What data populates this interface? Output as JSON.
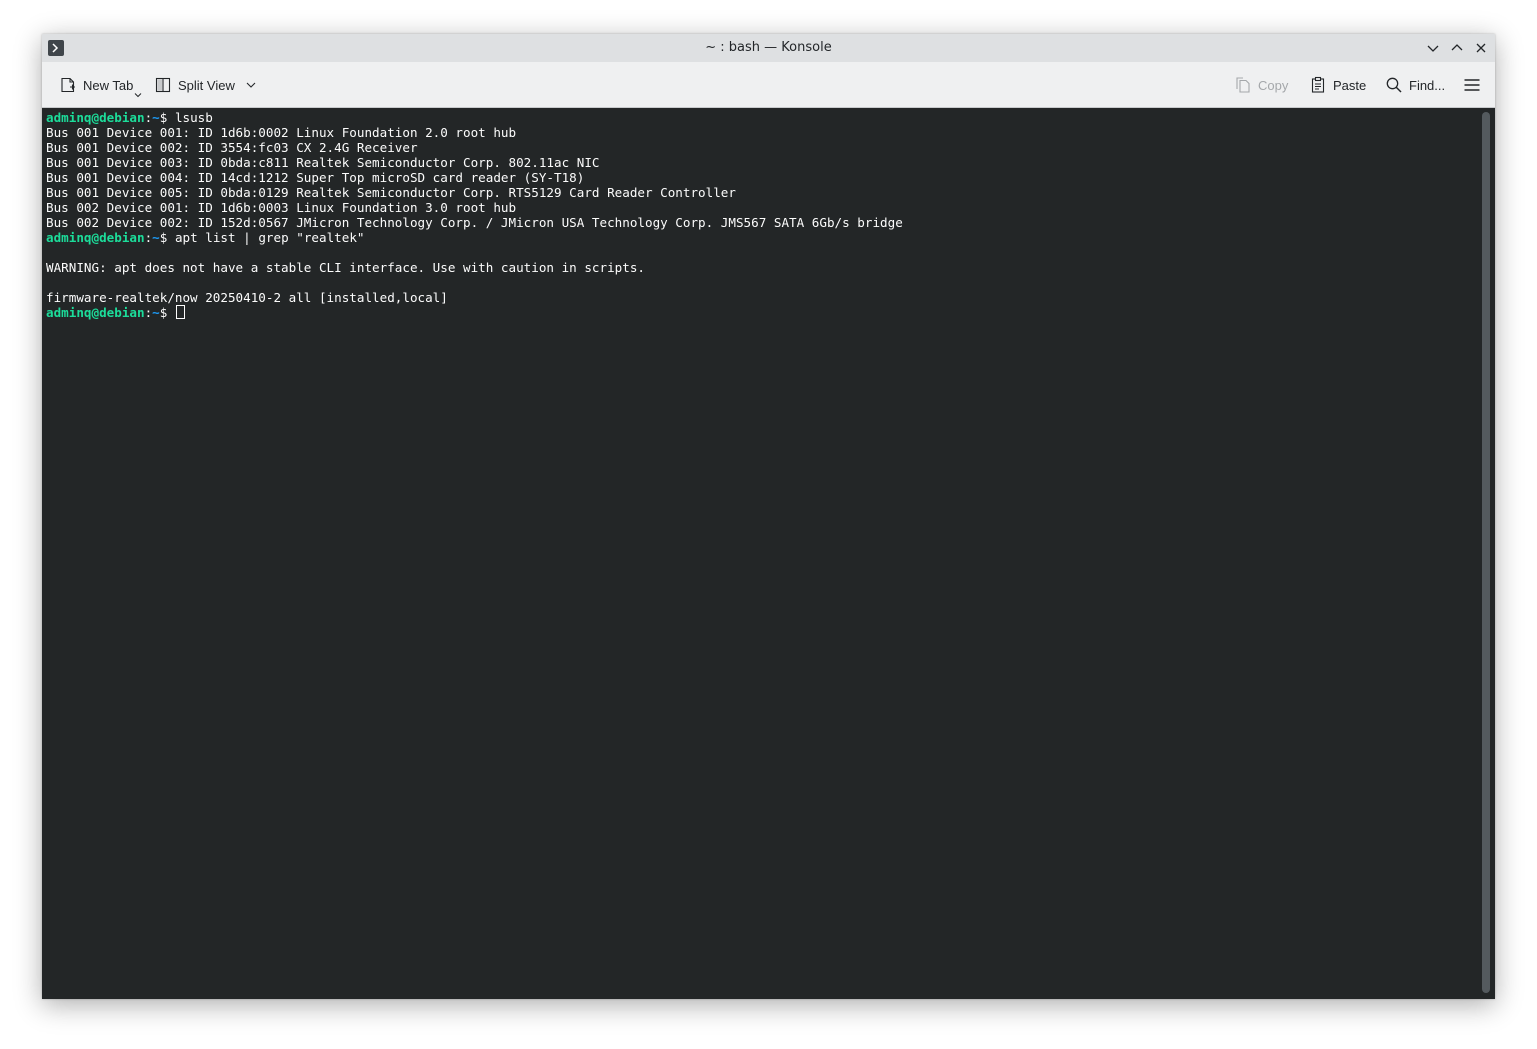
{
  "window": {
    "title": "~ : bash — Konsole",
    "icons": {
      "app": "konsole-terminal-icon",
      "minimize": "chevron-down-icon",
      "maximize": "chevron-up-icon",
      "close": "close-icon"
    }
  },
  "toolbar": {
    "new_tab": "New Tab",
    "split_view": "Split View",
    "copy": "Copy",
    "paste": "Paste",
    "find": "Find...",
    "copy_enabled": false
  },
  "prompt": {
    "user_host": "adminq@debian",
    "separator": ":",
    "path": "~",
    "symbol": "$ "
  },
  "terminal": {
    "lines": [
      {
        "type": "prompt",
        "text": "lsusb"
      },
      {
        "type": "output",
        "text": "Bus 001 Device 001: ID 1d6b:0002 Linux Foundation 2.0 root hub"
      },
      {
        "type": "output",
        "text": "Bus 001 Device 002: ID 3554:fc03 CX 2.4G Receiver"
      },
      {
        "type": "output",
        "text": "Bus 001 Device 003: ID 0bda:c811 Realtek Semiconductor Corp. 802.11ac NIC"
      },
      {
        "type": "output",
        "text": "Bus 001 Device 004: ID 14cd:1212 Super Top microSD card reader (SY-T18)"
      },
      {
        "type": "output",
        "text": "Bus 001 Device 005: ID 0bda:0129 Realtek Semiconductor Corp. RTS5129 Card Reader Controller"
      },
      {
        "type": "output",
        "text": "Bus 002 Device 001: ID 1d6b:0003 Linux Foundation 3.0 root hub"
      },
      {
        "type": "output",
        "text": "Bus 002 Device 002: ID 152d:0567 JMicron Technology Corp. / JMicron USA Technology Corp. JMS567 SATA 6Gb/s bridge"
      },
      {
        "type": "prompt",
        "text": "apt list | grep \"realtek\""
      },
      {
        "type": "output",
        "text": ""
      },
      {
        "type": "output",
        "text": "WARNING: apt does not have a stable CLI interface. Use with caution in scripts."
      },
      {
        "type": "output",
        "text": ""
      },
      {
        "type": "output",
        "text": "firmware-realtek/now 20250410-2 all [installed,local]"
      },
      {
        "type": "prompt_active",
        "text": ""
      }
    ]
  },
  "colors": {
    "terminal_bg": "#232627",
    "terminal_fg": "#fcfcfc",
    "prompt_user": "#1cdc9a",
    "prompt_path": "#1d99f3",
    "titlebar_bg": "#dee0e2",
    "toolbar_bg": "#eff0f1"
  }
}
